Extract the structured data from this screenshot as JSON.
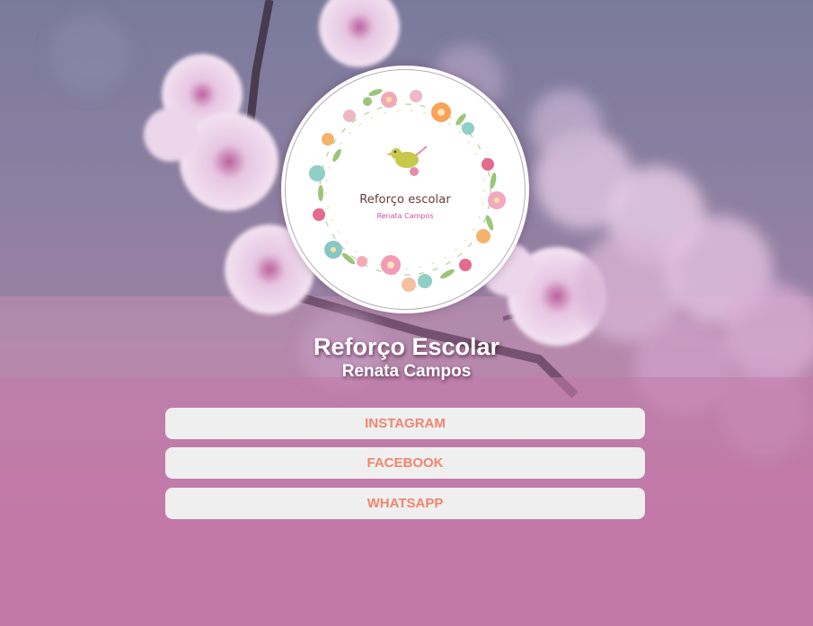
{
  "profile": {
    "logo_title": "Reforço escolar",
    "logo_subtitle": "Renata Campos",
    "title": "Reforço Escolar",
    "subtitle": "Renata Campos"
  },
  "links": [
    {
      "label": "INSTAGRAM"
    },
    {
      "label": "FACEBOOK"
    },
    {
      "label": "WHATSAPP"
    }
  ],
  "colors": {
    "button_bg": "#efefef",
    "button_text": "#f0856f",
    "title_text": "#ffffff"
  }
}
